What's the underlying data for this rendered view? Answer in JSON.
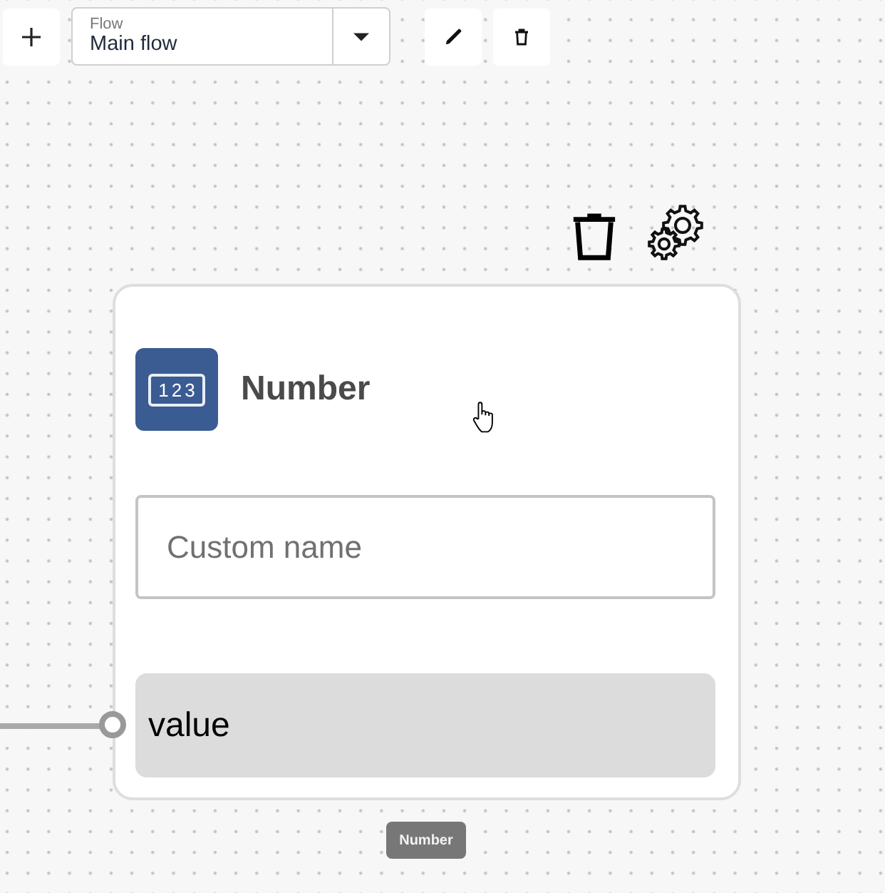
{
  "toolbar": {
    "flow_select": {
      "label": "Flow",
      "value": "Main flow"
    }
  },
  "node": {
    "title": "Number",
    "icon_text": "123",
    "name_field": {
      "placeholder": "Custom name"
    },
    "ports": [
      {
        "label": "value",
        "connected": true
      }
    ]
  },
  "node_tooltip": "Number"
}
